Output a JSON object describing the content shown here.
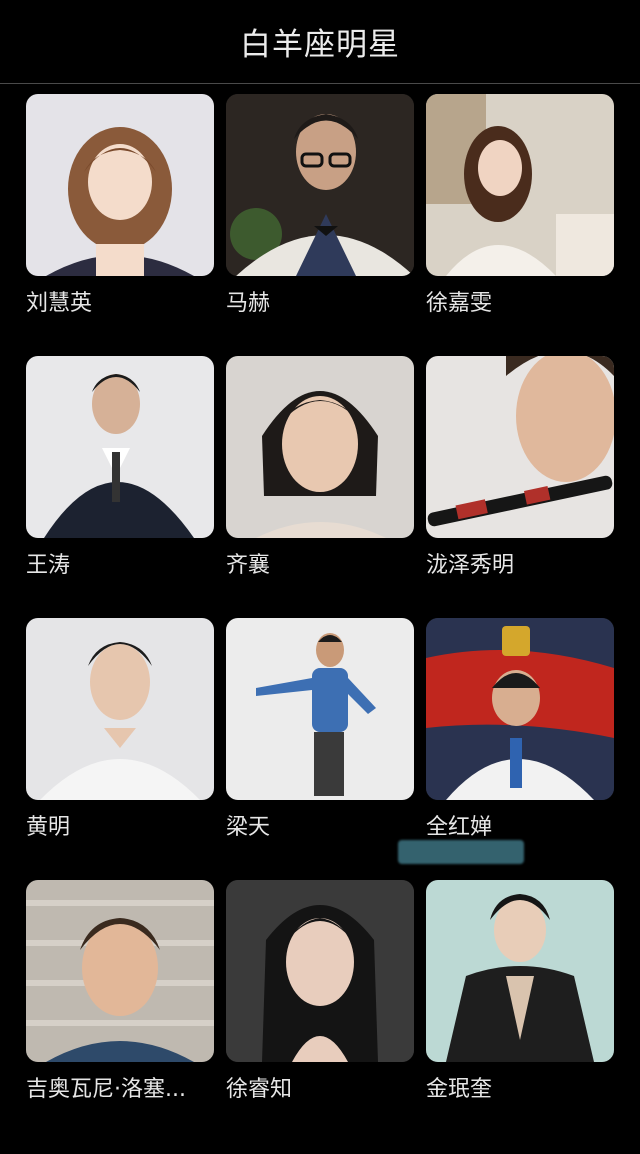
{
  "header": {
    "title": "白羊座明星"
  },
  "celebrities": [
    {
      "name": "刘慧英",
      "photo": "person-photo-icon",
      "bg": "#e4e3e8"
    },
    {
      "name": "马赫",
      "photo": "person-photo-icon",
      "bg": "#2c2622"
    },
    {
      "name": "徐嘉雯",
      "photo": "person-photo-icon",
      "bg": "#d9d2c6"
    },
    {
      "name": "王涛",
      "photo": "person-photo-icon",
      "bg": "#e8e8ea"
    },
    {
      "name": "齐襄",
      "photo": "person-photo-icon",
      "bg": "#d8d4d0"
    },
    {
      "name": "泷泽秀明",
      "photo": "person-photo-icon",
      "bg": "#e7e4e2"
    },
    {
      "name": "黄明",
      "photo": "person-photo-icon",
      "bg": "#e5e5e7"
    },
    {
      "name": "梁天",
      "photo": "person-photo-icon",
      "bg": "#ececec"
    },
    {
      "name": "全红婵",
      "photo": "person-photo-icon",
      "bg": "#2a3350"
    },
    {
      "name": "吉奥瓦尼·洛塞...",
      "photo": "person-photo-icon",
      "bg": "#bfb9b0"
    },
    {
      "name": "徐睿知",
      "photo": "person-photo-icon",
      "bg": "#3a3a3a"
    },
    {
      "name": "金珉奎",
      "photo": "person-photo-icon",
      "bg": "#bcd9d4"
    }
  ]
}
